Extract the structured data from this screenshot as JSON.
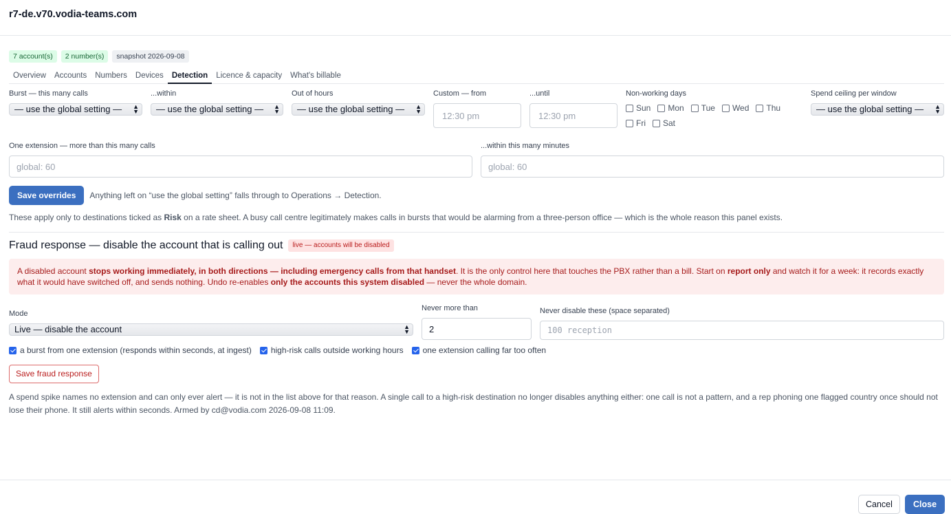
{
  "window_title": "r7-de.v70.vodia-teams.com",
  "badges": [
    "7 account(s)",
    "2 number(s)",
    "snapshot 2026-09-08"
  ],
  "tabs": [
    "Overview",
    "Accounts",
    "Numbers",
    "Devices",
    "Detection",
    "Licence & capacity",
    "What's billable"
  ],
  "active_tab": "Detection",
  "detection": {
    "burst_label": "Burst — this many calls",
    "burst_value": "— use the global setting —",
    "within_label": "...within",
    "within_value": "— use the global setting —",
    "ooh_label": "Out of hours",
    "ooh_value": "— use the global setting —",
    "from_label": "Custom — from",
    "from_value": "12:30 pm",
    "until_label": "...until",
    "until_value": "12:30 pm",
    "days_label": "Non-working days",
    "days": [
      "Sun",
      "Mon",
      "Tue",
      "Wed",
      "Thu",
      "Fri",
      "Sat"
    ],
    "spend_label": "Spend ceiling per window",
    "spend_value": "— use the global setting —",
    "ext_label": "One extension — more than this many calls",
    "ext_placeholder": "global: 60",
    "minutes_label": "...within this many minutes",
    "minutes_placeholder": "global: 60",
    "save_label": "Save overrides",
    "save_hint": "Anything left on “use the global setting” falls through to Operations → Detection.",
    "note_before": "These apply only to destinations ticked as ",
    "note_bold": "Risk",
    "note_after": " on a rate sheet. A busy call centre legitimately makes calls in bursts that would be alarming from a three-person office — which is the whole reason this panel exists."
  },
  "fraud": {
    "title": "Fraud response — disable the account that is calling out",
    "live_badge": "live — accounts will be disabled",
    "alert_1": "A disabled account ",
    "alert_b1": "stops working immediately, in both directions — including emergency calls from that handset",
    "alert_2": ". It is the only control here that touches the PBX rather than a bill. Start on ",
    "alert_b2": "report only",
    "alert_3": " and watch it for a week: it records exactly what it would have switched off, and sends nothing. Undo re-enables ",
    "alert_b3": "only the accounts this system disabled",
    "alert_4": " — never the whole domain.",
    "mode_label": "Mode",
    "mode_value": "Live — disable the account",
    "never_more_label": "Never more than",
    "never_more_value": "2",
    "never_disable_label": "Never disable these (space separated)",
    "never_disable_placeholder": "100 reception",
    "check_1": "a burst from one extension (responds within seconds, at ingest)",
    "check_2": "high-risk calls outside working hours",
    "check_3": "one extension calling far too often",
    "save_label": "Save fraud response",
    "footnote": "A spend spike names no extension and can only ever alert — it is not in the list above for that reason. A single call to a high-risk destination no longer disables anything either: one call is not a pattern, and a rep phoning one flagged country once should not lose their phone. It still alerts within seconds. Armed by cd@vodia.com 2026-09-08 11:09."
  },
  "footer": {
    "cancel_label": "Cancel",
    "close_label": "Close"
  },
  "colors": {
    "primary": "#3b6fc0",
    "danger": "#b91c1c",
    "alert_bg": "#fdeded"
  }
}
